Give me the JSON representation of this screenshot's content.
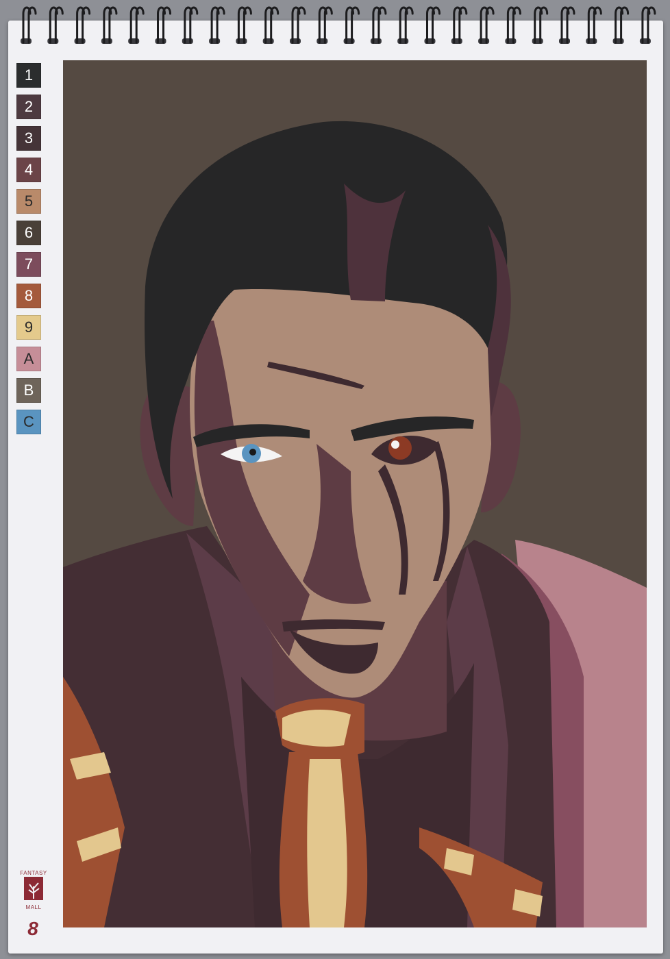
{
  "palette": [
    {
      "label": "1",
      "color": "#2b2d2e"
    },
    {
      "label": "2",
      "color": "#4d3a40"
    },
    {
      "label": "3",
      "color": "#453438"
    },
    {
      "label": "4",
      "color": "#6b4448"
    },
    {
      "label": "5",
      "color": "#b98a6a"
    },
    {
      "label": "6",
      "color": "#4a4038"
    },
    {
      "label": "7",
      "color": "#7c4c5c"
    },
    {
      "label": "8",
      "color": "#a45a3c"
    },
    {
      "label": "9",
      "color": "#e4ca8c"
    },
    {
      "label": "A",
      "color": "#c68e98"
    },
    {
      "label": "B",
      "color": "#6e645a"
    },
    {
      "label": "C",
      "color": "#5a94c0"
    }
  ],
  "brand": {
    "line1": "FANTASY",
    "line2": "MALL"
  },
  "page_number": "8",
  "colors": {
    "background": "#554a42",
    "hair": "#262627",
    "hair_highlight": "#4e323c",
    "skin": "#ae8c78",
    "shadow": "#5e3c44",
    "deep_shadow": "#3e2a30",
    "jacket": "#442e34",
    "jacket_light": "#5c3c48",
    "shirt": "#b8838c",
    "shirt_shadow": "#874e60",
    "tie_light": "#e3c78e",
    "tie_dark": "#9e5032",
    "eye_blue": "#5a94c0",
    "eye_brown": "#8c3a24"
  }
}
